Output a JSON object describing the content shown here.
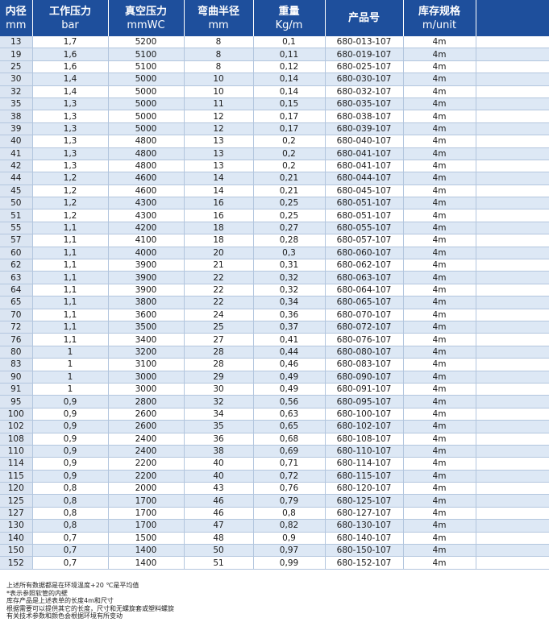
{
  "columns": [
    {
      "zh": "内径",
      "unit": "mm"
    },
    {
      "zh": "工作压力",
      "unit": "bar"
    },
    {
      "zh": "真空压力",
      "unit": "mmWC"
    },
    {
      "zh": "弯曲半径",
      "unit": "mm"
    },
    {
      "zh": "重量",
      "unit": "Kg/m"
    },
    {
      "zh": "产品号",
      "unit": ""
    },
    {
      "zh": "库存规格",
      "unit": "m/unit"
    },
    {
      "zh": "",
      "unit": ""
    }
  ],
  "rows": [
    [
      "13",
      "1,7",
      "5200",
      "8",
      "0,1",
      "680-013-107",
      "4m"
    ],
    [
      "19",
      "1,6",
      "5100",
      "8",
      "0,11",
      "680-019-107",
      "4m"
    ],
    [
      "25",
      "1,6",
      "5100",
      "8",
      "0,12",
      "680-025-107",
      "4m"
    ],
    [
      "30",
      "1,4",
      "5000",
      "10",
      "0,14",
      "680-030-107",
      "4m"
    ],
    [
      "32",
      "1,4",
      "5000",
      "10",
      "0,14",
      "680-032-107",
      "4m"
    ],
    [
      "35",
      "1,3",
      "5000",
      "11",
      "0,15",
      "680-035-107",
      "4m"
    ],
    [
      "38",
      "1,3",
      "5000",
      "12",
      "0,17",
      "680-038-107",
      "4m"
    ],
    [
      "39",
      "1,3",
      "5000",
      "12",
      "0,17",
      "680-039-107",
      "4m"
    ],
    [
      "40",
      "1,3",
      "4800",
      "13",
      "0,2",
      "680-040-107",
      "4m"
    ],
    [
      "41",
      "1,3",
      "4800",
      "13",
      "0,2",
      "680-041-107",
      "4m"
    ],
    [
      "42",
      "1,3",
      "4800",
      "13",
      "0,2",
      "680-041-107",
      "4m"
    ],
    [
      "44",
      "1,2",
      "4600",
      "14",
      "0,21",
      "680-044-107",
      "4m"
    ],
    [
      "45",
      "1,2",
      "4600",
      "14",
      "0,21",
      "680-045-107",
      "4m"
    ],
    [
      "50",
      "1,2",
      "4300",
      "16",
      "0,25",
      "680-051-107",
      "4m"
    ],
    [
      "51",
      "1,2",
      "4300",
      "16",
      "0,25",
      "680-051-107",
      "4m"
    ],
    [
      "55",
      "1,1",
      "4200",
      "18",
      "0,27",
      "680-055-107",
      "4m"
    ],
    [
      "57",
      "1,1",
      "4100",
      "18",
      "0,28",
      "680-057-107",
      "4m"
    ],
    [
      "60",
      "1,1",
      "4000",
      "20",
      "0,3",
      "680-060-107",
      "4m"
    ],
    [
      "62",
      "1,1",
      "3900",
      "21",
      "0,31",
      "680-062-107",
      "4m"
    ],
    [
      "63",
      "1,1",
      "3900",
      "22",
      "0,32",
      "680-063-107",
      "4m"
    ],
    [
      "64",
      "1,1",
      "3900",
      "22",
      "0,32",
      "680-064-107",
      "4m"
    ],
    [
      "65",
      "1,1",
      "3800",
      "22",
      "0,34",
      "680-065-107",
      "4m"
    ],
    [
      "70",
      "1,1",
      "3600",
      "24",
      "0,36",
      "680-070-107",
      "4m"
    ],
    [
      "72",
      "1,1",
      "3500",
      "25",
      "0,37",
      "680-072-107",
      "4m"
    ],
    [
      "76",
      "1,1",
      "3400",
      "27",
      "0,41",
      "680-076-107",
      "4m"
    ],
    [
      "80",
      "1",
      "3200",
      "28",
      "0,44",
      "680-080-107",
      "4m"
    ],
    [
      "83",
      "1",
      "3100",
      "28",
      "0,46",
      "680-083-107",
      "4m"
    ],
    [
      "90",
      "1",
      "3000",
      "29",
      "0,49",
      "680-090-107",
      "4m"
    ],
    [
      "91",
      "1",
      "3000",
      "30",
      "0,49",
      "680-091-107",
      "4m"
    ],
    [
      "95",
      "0,9",
      "2800",
      "32",
      "0,56",
      "680-095-107",
      "4m"
    ],
    [
      "100",
      "0,9",
      "2600",
      "34",
      "0,63",
      "680-100-107",
      "4m"
    ],
    [
      "102",
      "0,9",
      "2600",
      "35",
      "0,65",
      "680-102-107",
      "4m"
    ],
    [
      "108",
      "0,9",
      "2400",
      "36",
      "0,68",
      "680-108-107",
      "4m"
    ],
    [
      "110",
      "0,9",
      "2400",
      "38",
      "0,69",
      "680-110-107",
      "4m"
    ],
    [
      "114",
      "0,9",
      "2200",
      "40",
      "0,71",
      "680-114-107",
      "4m"
    ],
    [
      "115",
      "0,9",
      "2200",
      "40",
      "0,72",
      "680-115-107",
      "4m"
    ],
    [
      "120",
      "0,8",
      "2000",
      "43",
      "0,76",
      "680-120-107",
      "4m"
    ],
    [
      "125",
      "0,8",
      "1700",
      "46",
      "0,79",
      "680-125-107",
      "4m"
    ],
    [
      "127",
      "0,8",
      "1700",
      "46",
      "0,8",
      "680-127-107",
      "4m"
    ],
    [
      "130",
      "0,8",
      "1700",
      "47",
      "0,82",
      "680-130-107",
      "4m"
    ],
    [
      "140",
      "0,7",
      "1500",
      "48",
      "0,9",
      "680-140-107",
      "4m"
    ],
    [
      "150",
      "0,7",
      "1400",
      "50",
      "0,97",
      "680-150-107",
      "4m"
    ],
    [
      "152",
      "0,7",
      "1400",
      "51",
      "0,99",
      "680-152-107",
      "4m"
    ]
  ],
  "notes": [
    "上述所有数据都是在环境温度+20 ℃是平均值",
    "*表示参照软管的内壁",
    "库存产品是上述表单的长度4m和尺寸",
    "根据需要可以提供其它的长度，尺寸和无螺旋套或塑料螺旋",
    "有关技术参数和颜色会根据环境有所变动"
  ],
  "colors": {
    "header_bg": "#1e4f9c",
    "row_alt_bg": "#dde8f5",
    "first_col_bg": "#dbe5f2",
    "grid_line": "#b3c6de"
  }
}
